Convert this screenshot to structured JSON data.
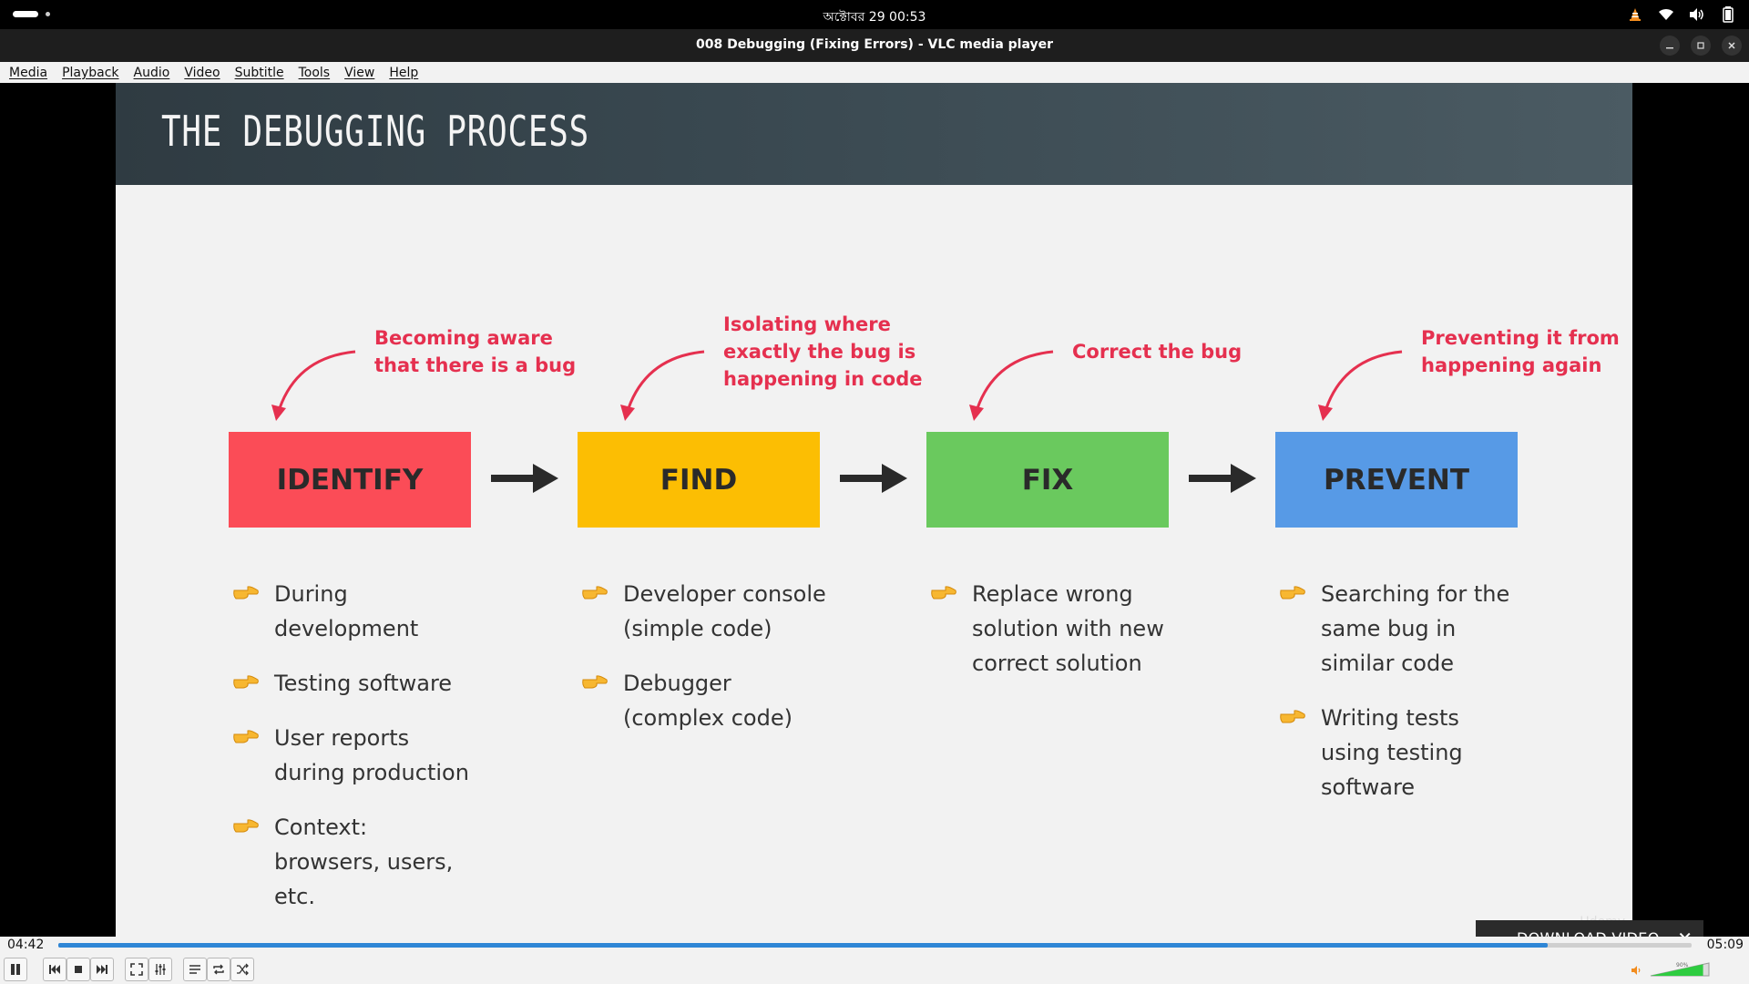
{
  "system_bar": {
    "clock": "অক্টোবর 29  00:53",
    "icons": [
      "vlc-cone-icon",
      "wifi-icon",
      "volume-icon",
      "battery-icon"
    ]
  },
  "window": {
    "title": "008 Debugging (Fixing Errors) - VLC media player"
  },
  "menu": [
    "Media",
    "Playback",
    "Audio",
    "Video",
    "Subtitle",
    "Tools",
    "View",
    "Help"
  ],
  "slide": {
    "title": "THE DEBUGGING PROCESS",
    "stages": [
      {
        "label": "IDENTIFY",
        "color": "#fb4c57",
        "annotation": "Becoming aware\nthat there is a bug",
        "bullets": [
          "During development",
          "Testing software",
          "User reports during production",
          "Context: browsers, users, etc."
        ]
      },
      {
        "label": "FIND",
        "color": "#fcbe03",
        "annotation": "Isolating where\nexactly the bug is\nhappening in code",
        "bullets": [
          "Developer console (simple code)",
          "Debugger (complex code)"
        ]
      },
      {
        "label": "FIX",
        "color": "#6ac95e",
        "annotation": "Correct the bug",
        "bullets": [
          "Replace wrong solution with new correct solution"
        ]
      },
      {
        "label": "PREVENT",
        "color": "#579ae6",
        "annotation": "Preventing it from\nhappening again",
        "bullets": [
          "Searching for the same bug in similar code",
          "Writing tests using testing software"
        ]
      }
    ],
    "watermark": "Udemy"
  },
  "player": {
    "elapsed": "04:42",
    "total": "05:09",
    "progress_fraction": 0.912,
    "volume_label": "90%",
    "download_label": "DOWNLOAD VIDEO"
  }
}
